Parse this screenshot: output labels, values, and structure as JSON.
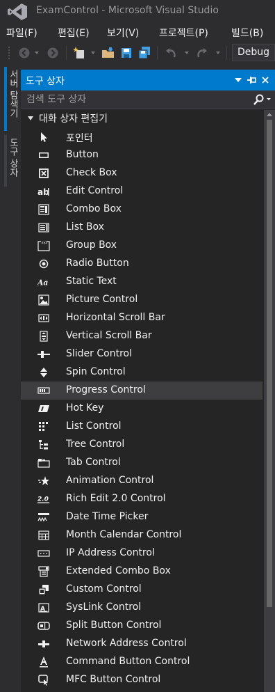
{
  "window": {
    "title": "ExamControl - Microsoft Visual Studio"
  },
  "menu": [
    "파일(F)",
    "편집(E)",
    "보기(V)",
    "프로젝트(P)",
    "빌드(B)"
  ],
  "toolbar": {
    "configuration": "Debug"
  },
  "side_tabs": [
    {
      "label": "서버 탐색기",
      "active": true
    },
    {
      "label": "도구 상자",
      "active": false
    }
  ],
  "panel": {
    "title": "도구 상자",
    "search_placeholder": "검색 도구 상자",
    "group": "대화 상자 편집기"
  },
  "tools": [
    {
      "label": "포인터",
      "icon": "pointer"
    },
    {
      "label": "Button",
      "icon": "button"
    },
    {
      "label": "Check Box",
      "icon": "checkbox"
    },
    {
      "label": "Edit Control",
      "icon": "edit"
    },
    {
      "label": "Combo Box",
      "icon": "combobox"
    },
    {
      "label": "List Box",
      "icon": "listbox"
    },
    {
      "label": "Group Box",
      "icon": "groupbox"
    },
    {
      "label": "Radio Button",
      "icon": "radio"
    },
    {
      "label": "Static Text",
      "icon": "statictext"
    },
    {
      "label": "Picture Control",
      "icon": "picture"
    },
    {
      "label": "Horizontal Scroll Bar",
      "icon": "hscroll"
    },
    {
      "label": "Vertical Scroll Bar",
      "icon": "vscroll"
    },
    {
      "label": "Slider Control",
      "icon": "slider"
    },
    {
      "label": "Spin Control",
      "icon": "spin"
    },
    {
      "label": "Progress Control",
      "icon": "progress",
      "selected": true
    },
    {
      "label": "Hot Key",
      "icon": "hotkey"
    },
    {
      "label": "List Control",
      "icon": "listcontrol"
    },
    {
      "label": "Tree Control",
      "icon": "tree"
    },
    {
      "label": "Tab Control",
      "icon": "tab"
    },
    {
      "label": "Animation Control",
      "icon": "animation"
    },
    {
      "label": "Rich Edit 2.0 Control",
      "icon": "richedit"
    },
    {
      "label": "Date Time Picker",
      "icon": "datetime"
    },
    {
      "label": "Month Calendar Control",
      "icon": "calendar"
    },
    {
      "label": "IP Address Control",
      "icon": "ipaddress"
    },
    {
      "label": "Extended Combo Box",
      "icon": "extcombo"
    },
    {
      "label": "Custom Control",
      "icon": "custom"
    },
    {
      "label": "SysLink Control",
      "icon": "syslink"
    },
    {
      "label": "Split Button Control",
      "icon": "splitbutton"
    },
    {
      "label": "Network Address Control",
      "icon": "netaddress"
    },
    {
      "label": "Command Button Control",
      "icon": "command"
    },
    {
      "label": "MFC Button Control",
      "icon": "mfcbutton"
    }
  ],
  "colors": {
    "accent": "#007acc",
    "background": "#2d2d30",
    "panel": "#252526",
    "selected_row": "#3e3e40"
  }
}
